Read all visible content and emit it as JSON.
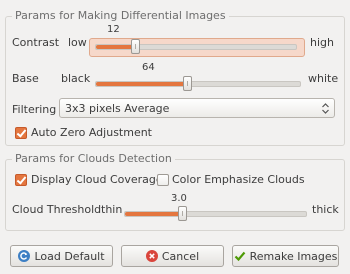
{
  "diff_group": {
    "title": "Params for Making Differential Images",
    "contrast": {
      "label": "Contrast",
      "low": "low",
      "high": "high",
      "value": "12",
      "fraction": 0.2
    },
    "base": {
      "label": "Base",
      "low": "black",
      "high": "white",
      "value": "64",
      "fraction": 0.45
    },
    "filtering": {
      "label": "Filtering",
      "selected": "3x3 pixels Average"
    },
    "auto_zero": {
      "label": "Auto Zero Adjustment",
      "checked": true
    }
  },
  "clouds_group": {
    "title": "Params for Clouds Detection",
    "display_coverage": {
      "label": "Display Cloud Coverage",
      "checked": true
    },
    "emphasize": {
      "label": "Color Emphasize Clouds",
      "checked": false
    },
    "threshold": {
      "label": "Cloud Threshold",
      "low": "thin",
      "high": "thick",
      "value": "3.0",
      "fraction": 0.32
    }
  },
  "buttons": {
    "load_default": "Load Default",
    "cancel": "Cancel",
    "remake": "Remake Images"
  },
  "colors": {
    "accent": "#e4763f",
    "cancel_icon": "#d9453c",
    "load_icon": "#3d7fc4",
    "remake_icon": "#4e9a06"
  },
  "icons": {
    "load_default": "refresh-icon",
    "cancel": "cancel-icon",
    "remake": "checkmark-icon",
    "combo": "updown-arrows-icon"
  }
}
